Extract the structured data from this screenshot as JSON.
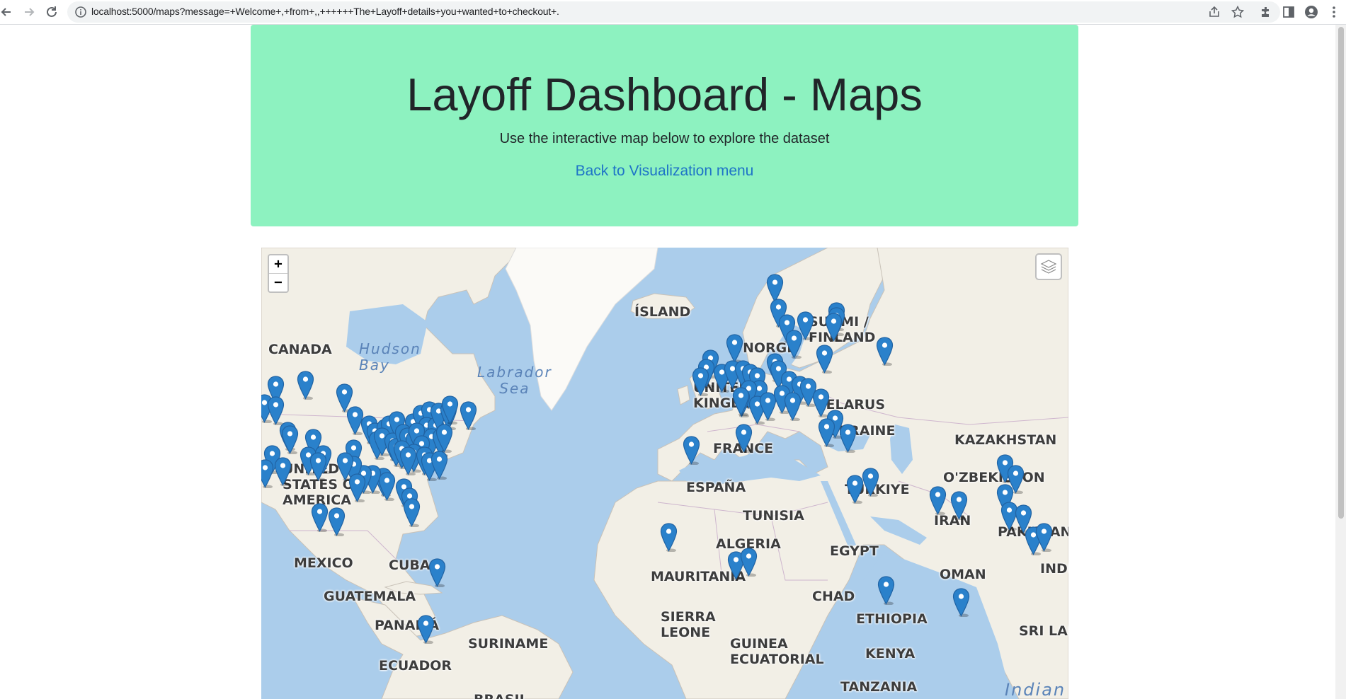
{
  "browser": {
    "url": "localhost:5000/maps?message=+Welcome+,+from+,,++++++The+Layoff+details+you+wanted+to+checkout+."
  },
  "page": {
    "title": "Layoff Dashboard - Maps",
    "subtitle": "Use the interactive map below to explore the dataset",
    "back_link": "Back to Visualization menu"
  },
  "map": {
    "zoom_in": "+",
    "zoom_out": "−",
    "layer_control_icon": "layers-icon",
    "marker_icon": "map-marker-icon",
    "marker_color": "#2a81cb",
    "labels": {
      "canada": "CANADA",
      "iceland": "ÍSLAND",
      "finland": "SUOMI /\nFINLAND",
      "norway": "NORGE",
      "uk": "UNITED\nKINGDOM",
      "belarus": "BELARUS",
      "ukraine": "UKRAINE",
      "kazakhstan": "KAZAKHSTAN",
      "uzbekistan": "O'ZBEKISTON",
      "france": "FRANCE",
      "spain": "ESPAÑA",
      "turkey": "TÜRKIYE",
      "usa": "UNITED\nSTATES OF\nAMERICA",
      "tunisia": "TUNISIA",
      "algeria": "ALGERIA",
      "egypt": "EGYPT",
      "iran": "IRAN",
      "pakistan": "PAKISTAN",
      "oman": "OMAN",
      "india": "INDIA",
      "mexico": "MEXICO",
      "cuba": "CUBA",
      "mauritania": "MAURITANIA",
      "chad": "CHAD",
      "guatemala": "GUATEMALA",
      "sierra_leone": "SIERRA\nLEONE",
      "eq_guinea": "GUINEA\nECUATORIAL",
      "ethiopia": "ETHIOPIA",
      "panama": "PANAMÁ",
      "suriname": "SURINAME",
      "sri_lanka": "SRI LANKA",
      "kenya": "KENYA",
      "ecuador": "ECUADOR",
      "tanzania": "TANZANIA",
      "brazil": "BRASIL"
    },
    "water_labels": {
      "hudson": "Hudson\nBay",
      "labrador": "Labrador\nSea",
      "indian": "Indian"
    }
  }
}
